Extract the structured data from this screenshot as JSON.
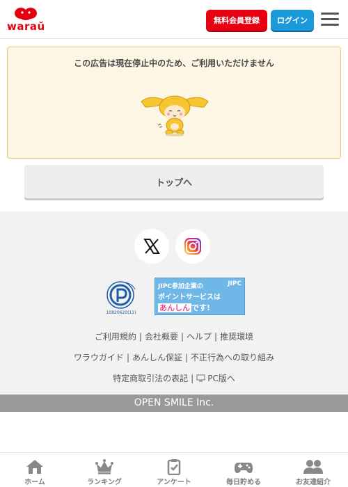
{
  "header": {
    "logo_text": "waraŭ",
    "register_label": "無料会員登録",
    "login_label": "ログイン"
  },
  "notice": {
    "message": "この広告は現在停止中のため、ご利用いただけません"
  },
  "top_button_label": "トップへ",
  "footer": {
    "privacy_number": "10820620(11)",
    "jipc": {
      "line1": "JIPC参加企業の",
      "logo": "JIPC",
      "line2": "ポイントサービスは",
      "line3a": "あんしん",
      "line3b": "です!"
    },
    "links_row1": [
      "ご利用規約",
      "会社概要",
      "ヘルプ",
      "推奨環境"
    ],
    "links_row2": [
      "ワラウガイド",
      "あんしん保証",
      "不正行為への取り組み"
    ],
    "links_row3": [
      "特定商取引法の表記",
      "PC版へ"
    ],
    "copyright": "OPEN SMILE Inc."
  },
  "bottom_nav": [
    {
      "label": "ホーム",
      "icon": "home-icon"
    },
    {
      "label": "ランキング",
      "icon": "crown-icon"
    },
    {
      "label": "アンケート",
      "icon": "survey-icon"
    },
    {
      "label": "毎日貯める",
      "icon": "gamepad-icon"
    },
    {
      "label": "お友達紹介",
      "icon": "friends-icon"
    }
  ],
  "colors": {
    "brand_red": "#e60012",
    "login_blue": "#1a9ad9",
    "notice_bg": "#fdf6e4",
    "notice_border": "#e8c766"
  }
}
